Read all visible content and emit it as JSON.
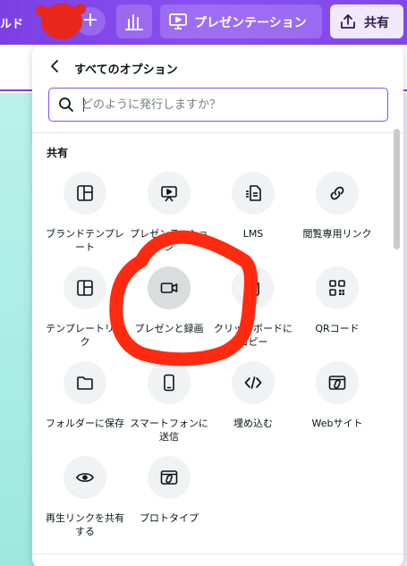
{
  "topbar": {
    "left_partial": "ルド",
    "present_label": "プレゼンテーション",
    "share_label": "共有"
  },
  "panel": {
    "title": "すべてのオプション",
    "search_placeholder": "どのように発行しますか？",
    "section_title": "共有",
    "items": [
      {
        "label": "ブランドテンプレート",
        "icon": "brand-template-icon"
      },
      {
        "label": "プレゼンテーション",
        "icon": "presentation-icon"
      },
      {
        "label": "LMS",
        "icon": "lms-icon"
      },
      {
        "label": "閲覧専用リンク",
        "icon": "link-icon"
      },
      {
        "label": "テンプレートリンク",
        "icon": "template-icon"
      },
      {
        "label": "プレゼンと録画",
        "icon": "video-camera-icon"
      },
      {
        "label": "クリップボードにコピー",
        "icon": "clipboard-icon"
      },
      {
        "label": "QRコード",
        "icon": "qr-code-icon"
      },
      {
        "label": "フォルダーに保存",
        "icon": "folder-icon"
      },
      {
        "label": "スマートフォンに送信",
        "icon": "smartphone-icon"
      },
      {
        "label": "埋め込む",
        "icon": "embed-code-icon"
      },
      {
        "label": "Webサイト",
        "icon": "website-icon"
      },
      {
        "label": "再生リンクを共有する",
        "icon": "eye-icon"
      },
      {
        "label": "プロトタイプ",
        "icon": "prototype-icon"
      }
    ]
  },
  "colors": {
    "accent": "#8b4ff2",
    "annotation_red": "#ff2a10"
  }
}
